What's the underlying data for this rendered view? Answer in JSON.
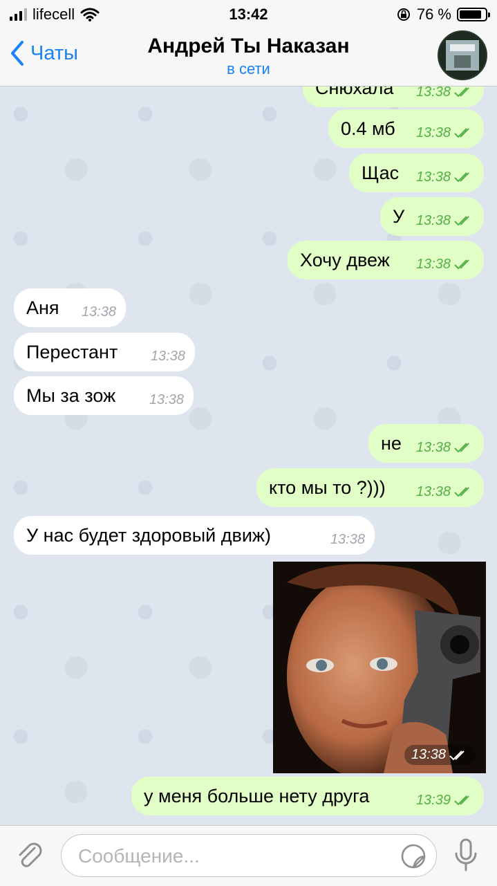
{
  "status_bar": {
    "carrier": "lifecell",
    "time": "13:42",
    "battery": "76 %"
  },
  "header": {
    "back_label": "Чаты",
    "title": "Андрей Ты Наказан",
    "status": "в сети"
  },
  "messages": [
    {
      "direction": "out",
      "text": "Снюхала",
      "time": "13:38",
      "read": true
    },
    {
      "direction": "out",
      "text": "0.4 мб",
      "time": "13:38",
      "read": true
    },
    {
      "direction": "out",
      "text": "Щас",
      "time": "13:38",
      "read": true
    },
    {
      "direction": "out",
      "text": "У",
      "time": "13:38",
      "read": true
    },
    {
      "direction": "out",
      "text": "Хочу двеж",
      "time": "13:38",
      "read": true
    },
    {
      "direction": "in",
      "text": "Аня",
      "time": "13:38"
    },
    {
      "direction": "in",
      "text": "Перестант",
      "time": "13:38"
    },
    {
      "direction": "in",
      "text": "Мы за зож",
      "time": "13:38"
    },
    {
      "direction": "out",
      "text": "не",
      "time": "13:38",
      "read": true
    },
    {
      "direction": "out",
      "text": "кто мы то ?)))",
      "time": "13:38",
      "read": true
    },
    {
      "direction": "in",
      "text": "У нас будет здоровый движ)",
      "time": "13:38"
    },
    {
      "direction": "out",
      "type": "photo",
      "time": "13:38",
      "read": true
    },
    {
      "direction": "out",
      "text": "у меня больше нету друга",
      "time": "13:39",
      "read": true
    }
  ],
  "input": {
    "placeholder": "Сообщение..."
  }
}
